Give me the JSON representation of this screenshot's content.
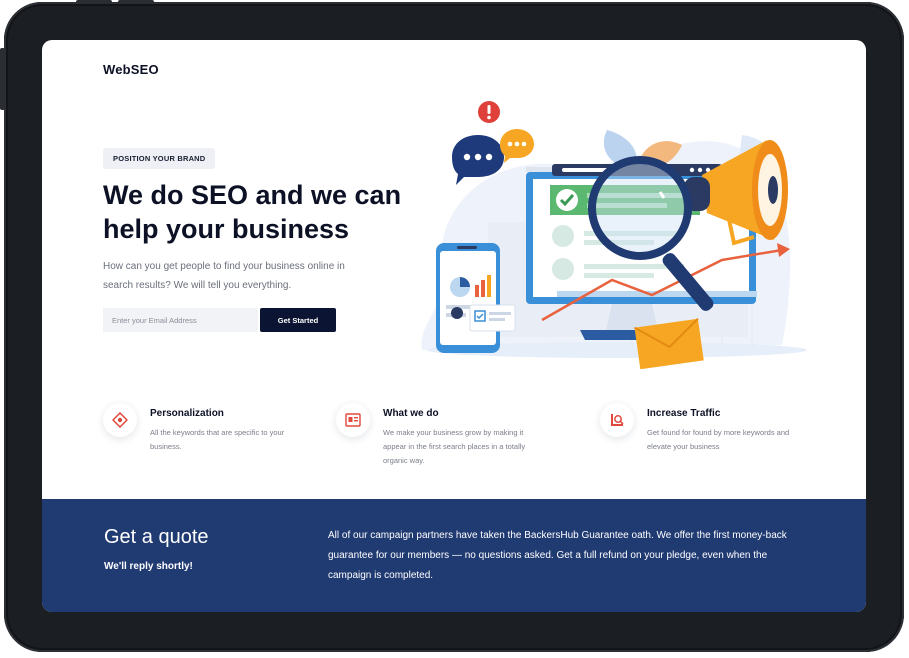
{
  "brand": {
    "logo": "WebSEO"
  },
  "hero": {
    "badge": "POSITION YOUR BRAND",
    "headline": "We do SEO and we can help your business",
    "subtext": "How can you get people to find your business online in search results? We will tell you everything.",
    "email_placeholder": "Enter your Email Address",
    "cta_label": "Get Started"
  },
  "features": [
    {
      "icon": "target-icon",
      "title": "Personalization",
      "text": "All the keywords that are specific to your business."
    },
    {
      "icon": "web-page-icon",
      "title": "What we do",
      "text": "We make your business grow by making it appear in the first search places in a totally organic way."
    },
    {
      "icon": "chart-magnifier-icon",
      "title": "Increase Traffic",
      "text": "Get found for found by more keywords and elevate your business"
    }
  ],
  "quote": {
    "title": "Get a quote",
    "subtitle": "We'll reply shortly!",
    "text": "All of our campaign partners have taken the BackersHub Guarantee oath. We offer the first money-back guarantee for our members — no questions asked. Get a full refund on your pledge, even when the campaign is completed."
  },
  "colors": {
    "accent_navy": "#0b1533",
    "quote_bg": "#203a72",
    "feature_icon_red": "#e0483c",
    "device_frame": "#1b1e22"
  }
}
